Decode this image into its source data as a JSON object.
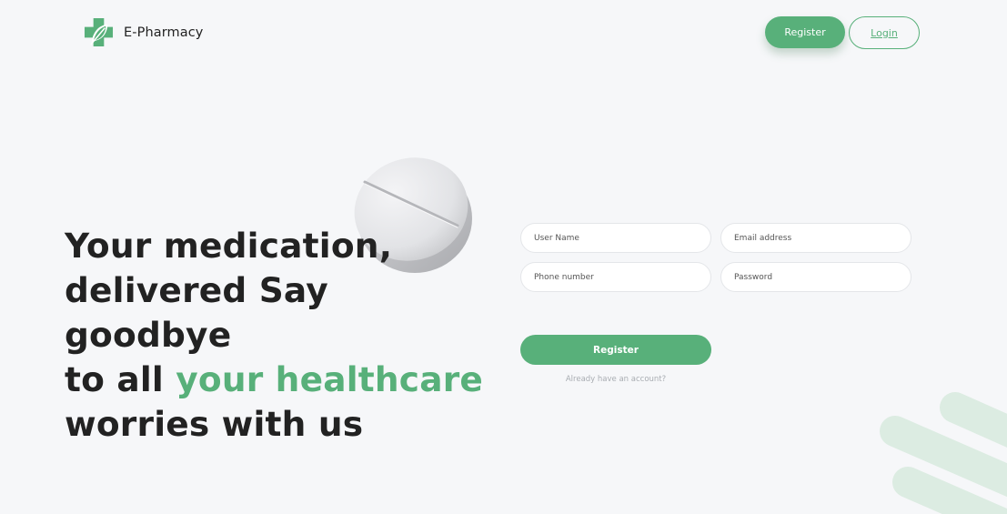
{
  "header": {
    "brand": "E-Pharmacy",
    "register_label": "Register",
    "login_label": "Login"
  },
  "hero": {
    "line1": "Your medication,",
    "line2": "delivered Say goodbye",
    "line3_prefix": "to all ",
    "line3_highlight": "your healthcare",
    "line4": "worries with us"
  },
  "form": {
    "username_placeholder": "User Name",
    "email_placeholder": "Email address",
    "phone_placeholder": "Phone number",
    "password_placeholder": "Password",
    "submit_label": "Register",
    "account_prompt": "Already have an account?"
  },
  "colors": {
    "accent": "#58b07a",
    "background": "#f6f7f9",
    "text": "#222222",
    "decor": "#dcece2"
  },
  "icons": {
    "logo": "medical-cross-leaf-icon",
    "illustration": "pill-tablet"
  }
}
